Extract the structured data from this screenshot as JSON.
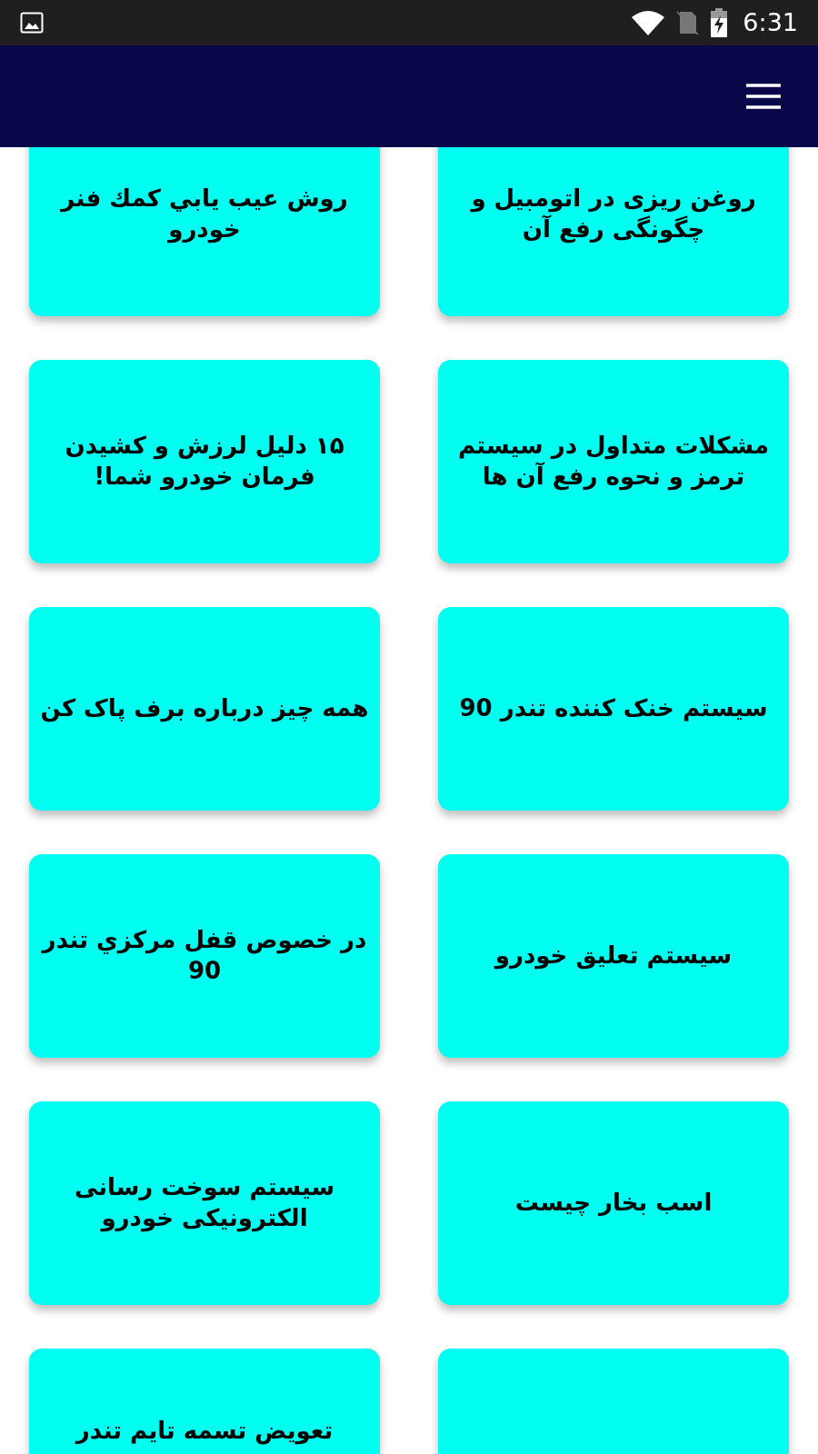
{
  "status_bar": {
    "time": "6:31"
  },
  "columns": [
    {
      "cards": [
        {
          "title": "روغن ریزی در اتومبیل و چگونگی رفع آن"
        },
        {
          "title": "مشکلات متداول در سیستم ترمز و نحوه رفع آن ها"
        },
        {
          "title": "سیستم خنک کننده تندر 90"
        },
        {
          "title": "سیستم تعلیق خودرو"
        },
        {
          "title": "اسب بخار چیست"
        }
      ]
    },
    {
      "cards": [
        {
          "title": "روش عیب یابي کمك فنر خودرو"
        },
        {
          "title": "۱۵ دلیل لرزش و کشیدن فرمان خودرو شما!"
        },
        {
          "title": "همه چیز درباره برف پاک کن"
        },
        {
          "title": "در خصوص قفل مرکزي تندر 90"
        },
        {
          "title": "سیستم سوخت رسانی الکترونیکی خودرو"
        },
        {
          "title": "تعویض تسمه تایم تندر"
        }
      ]
    }
  ]
}
